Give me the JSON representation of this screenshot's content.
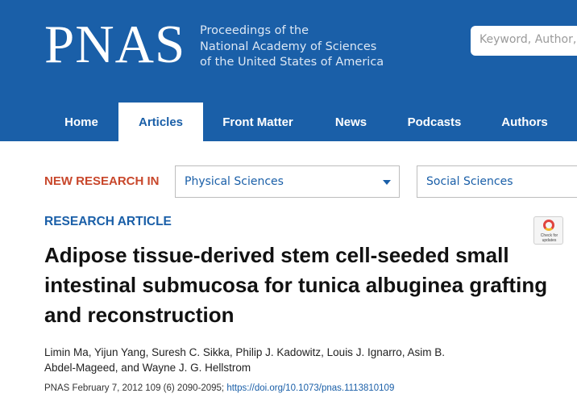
{
  "header": {
    "logo": "PNAS",
    "tagline": [
      "Proceedings of the",
      "National Academy of Sciences",
      "of the United States of America"
    ],
    "search_placeholder": "Keyword, Author, or DOI",
    "bg_color": "#1a5fa8"
  },
  "nav": {
    "items": [
      {
        "label": "Home",
        "active": false
      },
      {
        "label": "Articles",
        "active": true
      },
      {
        "label": "Front Matter",
        "active": false
      },
      {
        "label": "News",
        "active": false
      },
      {
        "label": "Podcasts",
        "active": false
      },
      {
        "label": "Authors",
        "active": false
      }
    ]
  },
  "new_research": {
    "label": "NEW RESEARCH IN",
    "select1": "Physical Sciences",
    "select2": "Social Sciences"
  },
  "article": {
    "type": "RESEARCH ARTICLE",
    "title": "Adipose tissue-derived stem cell-seeded small intestinal submucosa for tunica albuginea grafting and reconstruction",
    "authors": "Limin Ma, Yijun Yang, Suresh C. Sikka, Philip J. Kadowitz, Louis J. Ignarro, Asim B. Abdel-Mageed, and Wayne J. G. Hellstrom",
    "citation_prefix": "PNAS February 7, 2012 109 (6) 2090-2095; ",
    "doi": "https://doi.org/10.1073/pnas.1113810109",
    "badge_text": [
      "Check for",
      "updates"
    ]
  },
  "colors": {
    "accent": "#1a5fa8",
    "new_research_label": "#c8472b"
  }
}
